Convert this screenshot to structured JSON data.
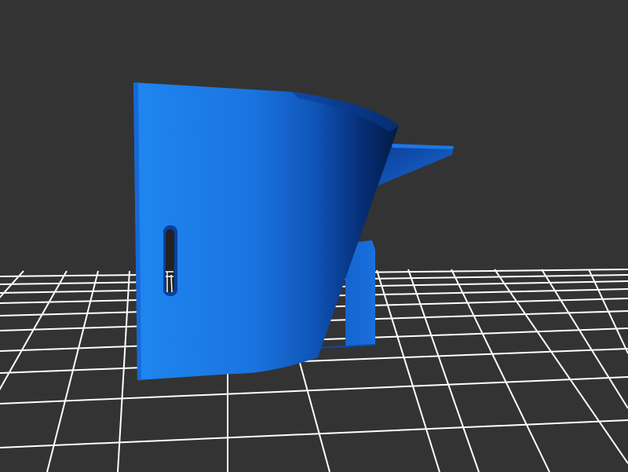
{
  "viewport": {
    "background_color": "#333333",
    "grid_color": "#ffffff",
    "model_color": "#1f7fe8",
    "model_shade_color": "#0b3a8c",
    "model_dark_color": "#041a44"
  }
}
